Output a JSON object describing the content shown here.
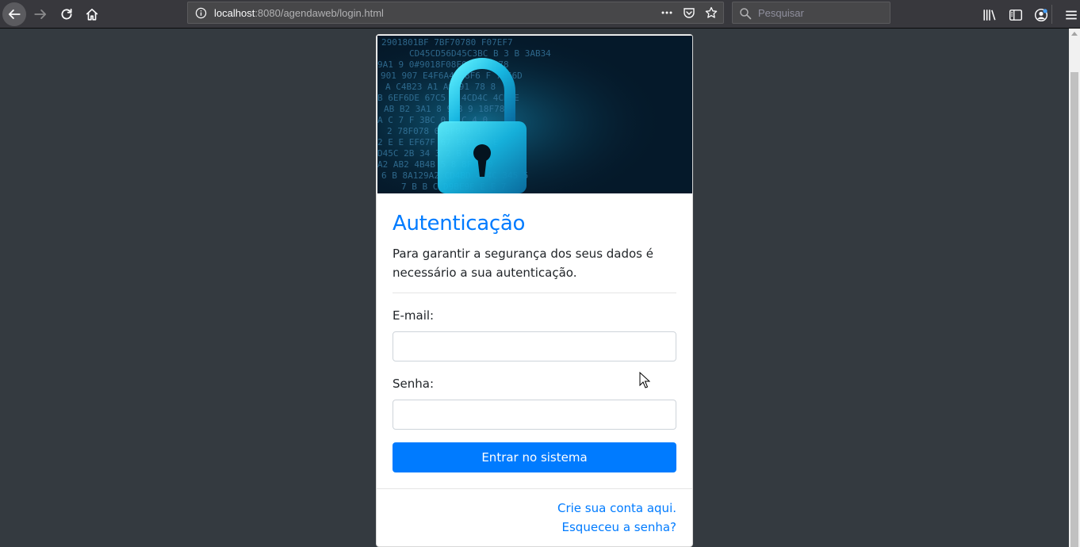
{
  "browser": {
    "url_host": "localhost",
    "url_rest": ":8080/agendaweb/login.html",
    "search_placeholder": "Pesquisar",
    "icons": [
      "back-icon",
      "forward-icon",
      "reload-icon",
      "home-icon",
      "info-icon",
      "page-actions-icon",
      "pocket-icon",
      "bookmark-star-icon",
      "search-icon",
      "library-icon",
      "sidebar-icon",
      "account-icon",
      "hamburger-menu-icon"
    ]
  },
  "card": {
    "image_alt_icon": "padlock-hero-image",
    "title": "Autenticação",
    "description": "Para garantir a segurança dos seus dados é necessário a sua autenticação.",
    "email_label": "E-mail:",
    "email_value": "",
    "password_label": "Senha:",
    "password_value": "",
    "submit_label": "Entrar no sistema",
    "create_account_link": "Crie sua conta aqui.",
    "forgot_password_link": "Esqueceu a senha?"
  },
  "colors": {
    "page_bg": "#343a40",
    "primary": "#007bff",
    "toolbar_bg": "#38383d"
  }
}
